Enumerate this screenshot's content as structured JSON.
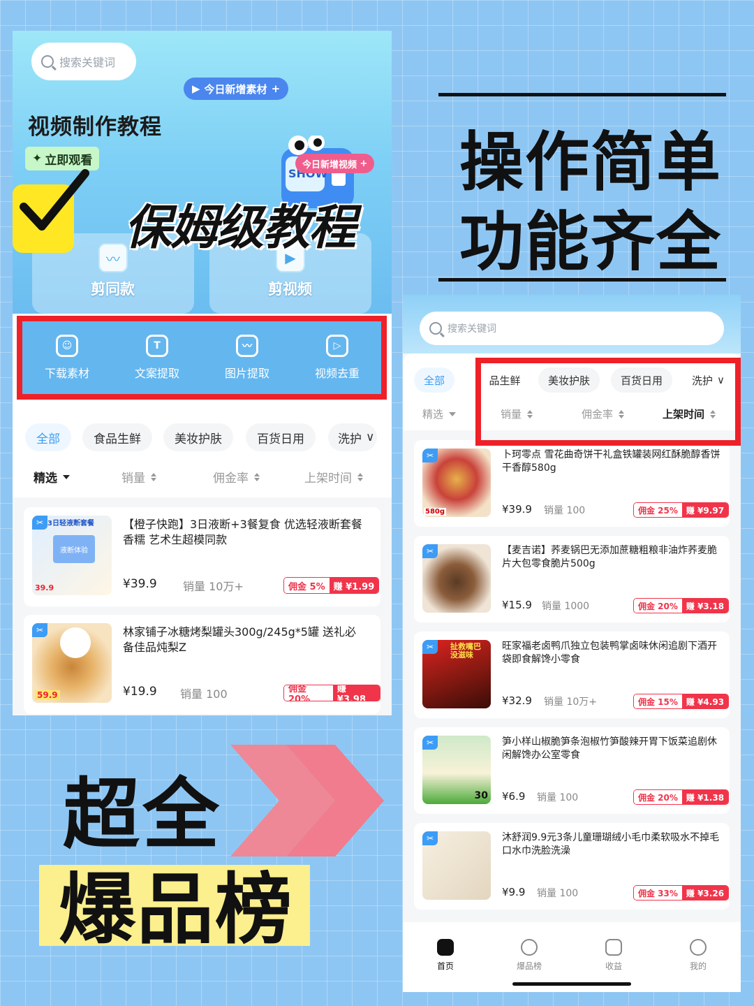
{
  "left_panel": {
    "search_placeholder": "搜索关键词",
    "bubble_new_material": "今日新增素材",
    "bubble_new_video": "今日新增视频",
    "hero_title": "视频制作教程",
    "watch_now": "立即观看",
    "slogan": "保姆级教程",
    "robot_text": "SHOW",
    "cards": [
      {
        "label": "剪同款",
        "icon": "wave-icon"
      },
      {
        "label": "剪视频",
        "icon": "play-icon"
      }
    ],
    "tools": [
      {
        "label": "下载素材",
        "icon": "download-icon"
      },
      {
        "label": "文案提取",
        "icon": "text-icon"
      },
      {
        "label": "图片提取",
        "icon": "image-icon"
      },
      {
        "label": "视频去重",
        "icon": "video-dedupe-icon"
      }
    ],
    "categories": [
      "全部",
      "食品生鲜",
      "美妆护肤",
      "百货日用",
      "洗护"
    ],
    "filters": [
      "精选",
      "销量",
      "佣金率",
      "上架时间"
    ],
    "products": [
      {
        "badge": "✂",
        "title": "【橙子快跑】3日液断+3餐复食 优选轻液断套餐 香糯 艺术生超模同款",
        "price": "¥39.9",
        "sales": "销量 10万+",
        "commission": "佣金 5%",
        "earn": "赚 ¥1.99",
        "img_label": "3日轻液断套餐",
        "img_label2": "液断体验",
        "img_price": "39.9"
      },
      {
        "badge": "✂",
        "title": "林家铺子冰糖烤梨罐头300g/245g*5罐 送礼必备佳品炖梨Z",
        "price": "¥19.9",
        "sales": "销量 100",
        "commission": "佣金 20%",
        "earn": "赚 ¥3.98",
        "img_price": "59.9"
      }
    ]
  },
  "right_panel": {
    "search_placeholder": "搜索关键词",
    "categories": [
      "全部",
      "品生鲜",
      "美妆护肤",
      "百货日用",
      "洗护"
    ],
    "filters": [
      "精选",
      "销量",
      "佣金率",
      "上架时间"
    ],
    "products": [
      {
        "badge": "✂",
        "title": "卜珂零点 雪花曲奇饼干礼盒铁罐装网红酥脆醇香饼干香醇580g",
        "price": "¥39.9",
        "sales": "销量 100",
        "commission": "佣金 25%",
        "earn": "赚 ¥9.97",
        "img_tag": "580g"
      },
      {
        "badge": "✂",
        "title": "【麦吉诺】荞麦锅巴无添加蔗糖粗粮非油炸荞麦脆片大包零食脆片500g",
        "price": "¥15.9",
        "sales": "销量 1000",
        "commission": "佣金 20%",
        "earn": "赚 ¥3.18"
      },
      {
        "badge": "✂",
        "title": "旺家福老卤鸭爪独立包装鸭掌卤味休闲追剧下酒开袋即食解馋小零食",
        "price": "¥32.9",
        "sales": "销量 10万+",
        "commission": "佣金 15%",
        "earn": "赚 ¥4.93",
        "img_tag": "扯救嘴巴没滋味"
      },
      {
        "badge": "✂",
        "title": "笋小样山椒脆笋条泡椒竹笋酸辣开胃下饭菜追剧休闲解馋办公室零食",
        "price": "¥6.9",
        "sales": "销量 100",
        "commission": "佣金 20%",
        "earn": "赚 ¥1.38",
        "img_tag": "30"
      },
      {
        "badge": "✂",
        "title": "沐舒润9.9元3条儿童珊瑚绒小毛巾柔软吸水不掉毛口水巾洗脸洗澡",
        "price": "¥9.9",
        "sales": "销量 100",
        "commission": "佣金 33%",
        "earn": "赚 ¥3.26"
      }
    ],
    "tabs": [
      {
        "label": "首页",
        "icon": "home-icon"
      },
      {
        "label": "爆品榜",
        "icon": "sparkle-icon"
      },
      {
        "label": "收益",
        "icon": "wallet-icon"
      },
      {
        "label": "我的",
        "icon": "smile-icon"
      }
    ]
  },
  "headline": {
    "line1": "操作简单",
    "line2": "功能齐全"
  },
  "promo": {
    "line1": "超全",
    "line2": "爆品榜"
  },
  "colors": {
    "accent": "#3d9cf5",
    "red": "#ee2128",
    "yellow": "#ffe823"
  }
}
